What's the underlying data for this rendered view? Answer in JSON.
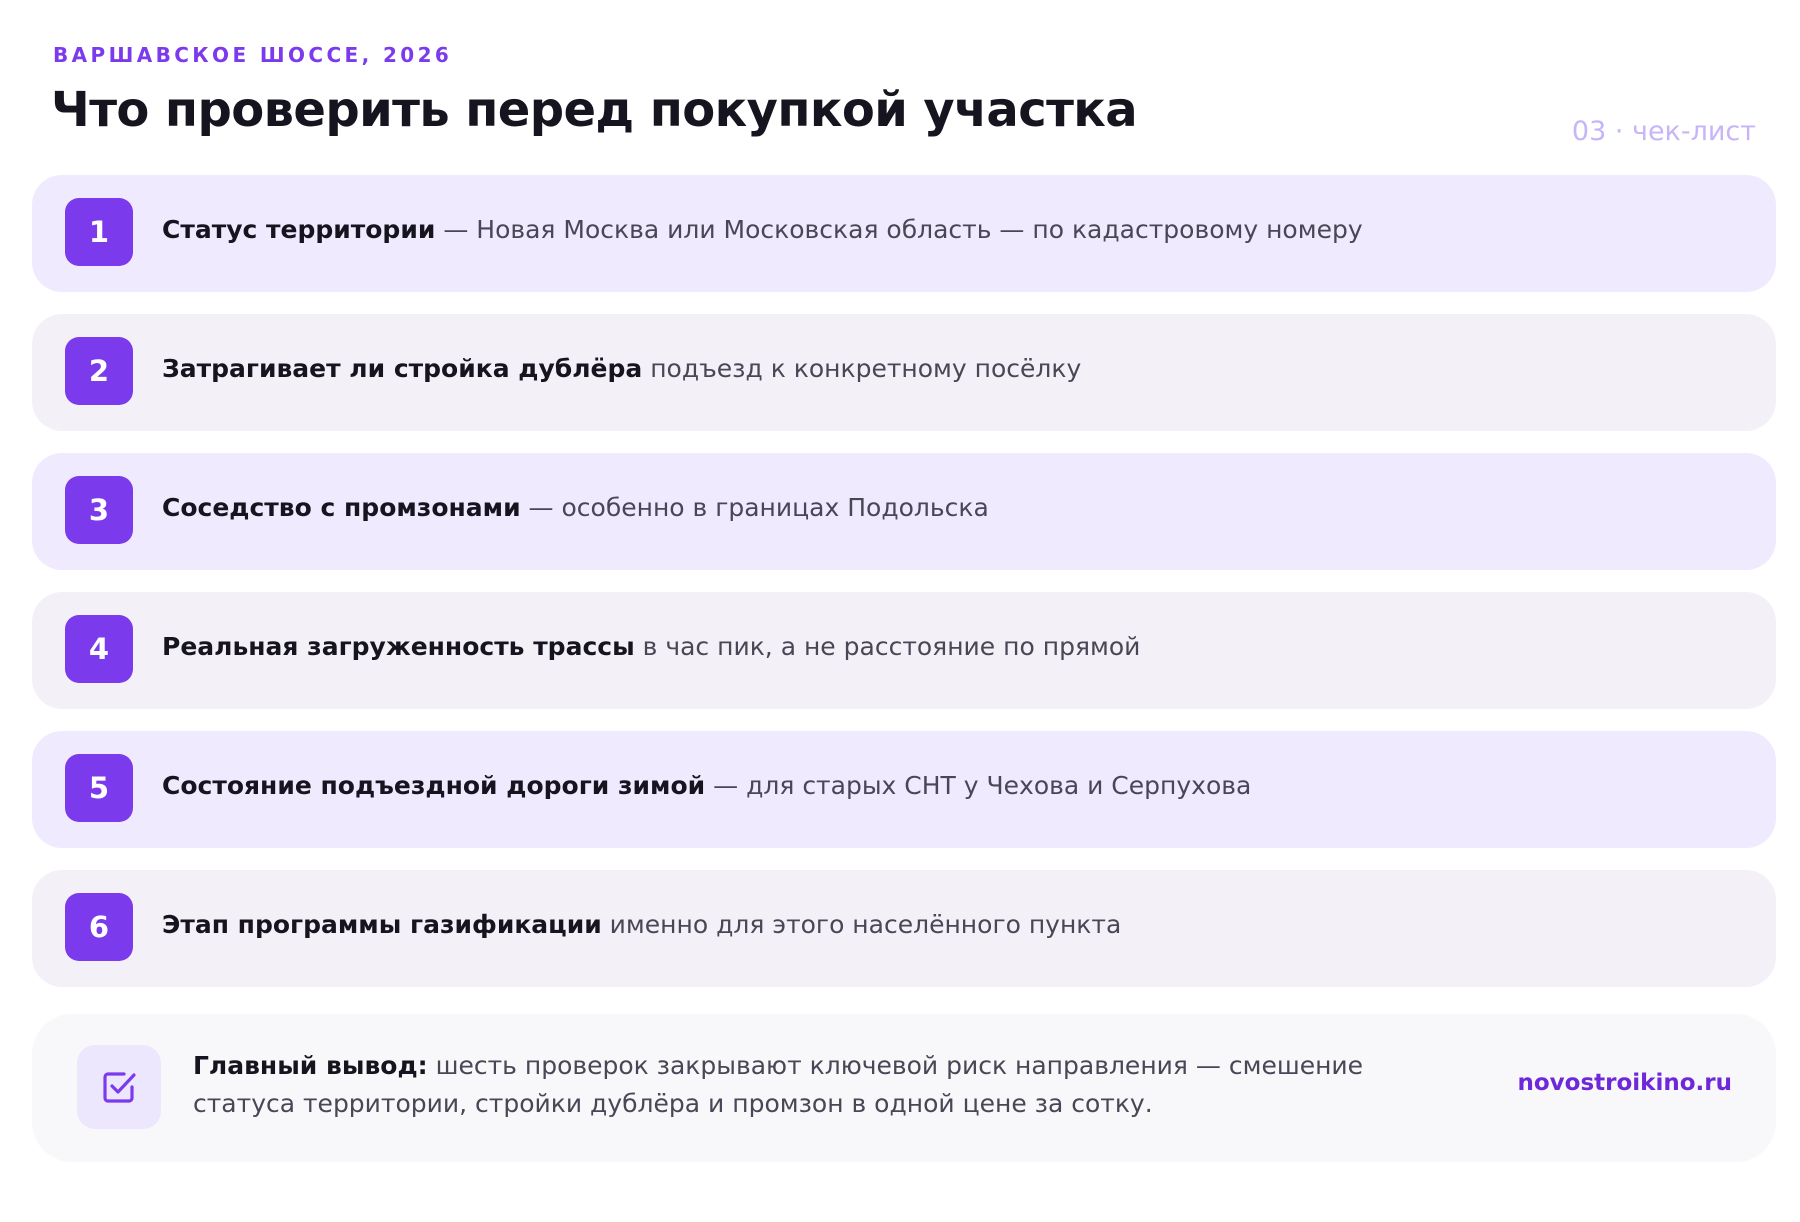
{
  "header": {
    "kicker": "ВАРШАВСКОЕ ШОССЕ, 2026",
    "title": "Что проверить перед покупкой участка",
    "tag": "03 · чек-лист"
  },
  "items": [
    {
      "num": "1",
      "bold": "Статус территории",
      "rest": " — Новая Москва или Московская область — по кадастровому номеру"
    },
    {
      "num": "2",
      "bold": "Затрагивает ли стройка дублёра",
      "rest": " подъезд к конкретному посёлку"
    },
    {
      "num": "3",
      "bold": "Соседство с промзонами",
      "rest": " — особенно в границах Подольска"
    },
    {
      "num": "4",
      "bold": "Реальная загруженность трассы",
      "rest": " в час пик, а не расстояние по прямой"
    },
    {
      "num": "5",
      "bold": "Состояние подъездной дороги зимой",
      "rest": " — для старых СНТ у Чехова и Серпухова"
    },
    {
      "num": "6",
      "bold": "Этап программы газификации",
      "rest": " именно для этого населённого пункта"
    }
  ],
  "summary": {
    "icon": "checkbox-check-icon",
    "bold": "Главный вывод:",
    "text": " шесть проверок закрывают ключевой риск направления — смешение статуса территории, стройки дублёра и промзон в одной цене за сотку.",
    "link": "novostroikino.ru"
  },
  "colors": {
    "accent": "#7c3aed",
    "odd_row": "#efeafd",
    "even_row": "#f3f1f7",
    "tag": "#c7b5f7"
  }
}
